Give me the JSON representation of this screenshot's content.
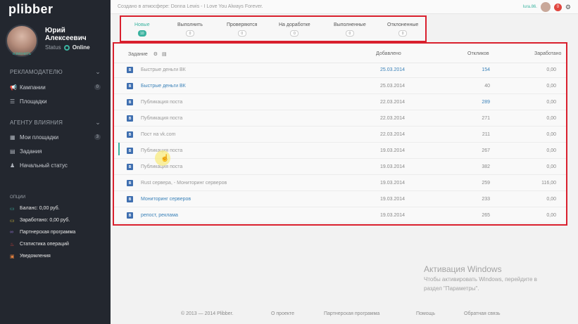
{
  "brand": "plibber",
  "profile": {
    "name_line1": "Юрий",
    "name_line2": "Алексеевич",
    "status_label": "Status",
    "status_value": "Online",
    "edit_link": "изменить"
  },
  "sidebar": {
    "advertiser_section": "РЕКЛАМОДАТЕЛЮ",
    "advertiser_items": [
      {
        "label": "Кампании",
        "badge": "0",
        "icon": "megaphone-icon"
      },
      {
        "label": "Площадки",
        "badge": "",
        "icon": "list-icon"
      }
    ],
    "agent_section": "АГЕНТУ ВЛИЯНИЯ",
    "agent_items": [
      {
        "label": "Мои площадки",
        "badge": "3",
        "icon": "grid-icon"
      },
      {
        "label": "Задания",
        "badge": "",
        "icon": "document-icon"
      },
      {
        "label": "Начальный статус",
        "badge": "",
        "icon": "person-icon"
      }
    ],
    "options_section": "ОПЦИИ",
    "options": [
      {
        "label": "Баланс: 0,00 руб.",
        "icon": "wallet-icon",
        "color": "#3bb3a0"
      },
      {
        "label": "Заработано: 0,00 руб.",
        "icon": "money-icon",
        "color": "#c9b23a"
      },
      {
        "label": "Партнерская программа",
        "icon": "infinity-icon",
        "color": "#8a6cc2"
      },
      {
        "label": "Статистика операций",
        "icon": "flask-icon",
        "color": "#e0463f"
      },
      {
        "label": "Уведомления",
        "icon": "bell-icon",
        "color": "#e0803f"
      }
    ]
  },
  "topbar": {
    "now_playing": "Создано в атмосфере: Donna Lewis - I Love You Always Forever.",
    "username": "lura.86.",
    "notifications": "0"
  },
  "tabs": [
    {
      "label": "Новые",
      "count": "10",
      "active": true
    },
    {
      "label": "Выполнить",
      "count": "0",
      "active": false
    },
    {
      "label": "Проверяются",
      "count": "0",
      "active": false
    },
    {
      "label": "На доработке",
      "count": "0",
      "active": false
    },
    {
      "label": "Выполненные",
      "count": "0",
      "active": false
    },
    {
      "label": "Отклоненные",
      "count": "0",
      "active": false
    }
  ],
  "table": {
    "headers": {
      "task": "Задание",
      "added": "Добавлено",
      "responses": "Откликов",
      "earned": "Заработано"
    },
    "rows": [
      {
        "name": "Быстрые деньги ВК",
        "date": "25.03.2014",
        "responses": "154",
        "earned": "0,00",
        "name_link": false,
        "date_link": true,
        "resp_link": true
      },
      {
        "name": "Быстрые деньги ВК",
        "date": "25.03.2014",
        "responses": "40",
        "earned": "0,00",
        "name_link": true,
        "date_link": false,
        "resp_link": false
      },
      {
        "name": "Публикация поста",
        "date": "22.03.2014",
        "responses": "289",
        "earned": "0,00",
        "name_link": false,
        "date_link": false,
        "resp_link": true
      },
      {
        "name": "Публикация поста",
        "date": "22.03.2014",
        "responses": "271",
        "earned": "0,00",
        "name_link": false,
        "date_link": false,
        "resp_link": false
      },
      {
        "name": "Пост на vk.com",
        "date": "22.03.2014",
        "responses": "211",
        "earned": "0,00",
        "name_link": false,
        "date_link": false,
        "resp_link": false
      },
      {
        "name": "Публикация поста",
        "date": "19.03.2014",
        "responses": "267",
        "earned": "0,00",
        "name_link": false,
        "date_link": false,
        "resp_link": false
      },
      {
        "name": "Публикация поста",
        "date": "19.03.2014",
        "responses": "382",
        "earned": "0,00",
        "name_link": false,
        "date_link": false,
        "resp_link": false
      },
      {
        "name": "Rust сервера, - Мониторинг серверов",
        "date": "19.03.2014",
        "responses": "259",
        "earned": "116,00",
        "name_link": false,
        "date_link": false,
        "resp_link": false
      },
      {
        "name": "Мониторинг серверов",
        "date": "19.03.2014",
        "responses": "233",
        "earned": "0,00",
        "name_link": true,
        "date_link": false,
        "resp_link": false
      },
      {
        "name": "репост, реклама",
        "date": "19.03.2014",
        "responses": "265",
        "earned": "0,00",
        "name_link": true,
        "date_link": false,
        "resp_link": false
      }
    ]
  },
  "footer": {
    "copyright": "© 2013 — 2014 Plibber.",
    "about": "О проекте",
    "partner": "Партнерская программа",
    "help": "Помощь",
    "feedback": "Обратная связь"
  },
  "watermark": {
    "title": "Активация Windows",
    "line1": "Чтобы активировать Windows, перейдите в",
    "line2": "раздел \"Параметры\"."
  },
  "colors": {
    "accent": "#3bb3a0",
    "link": "#3b82b9",
    "highlight_border": "#d9202e",
    "sidebar_bg": "#23272f",
    "vk_blue": "#3f6fb0"
  }
}
